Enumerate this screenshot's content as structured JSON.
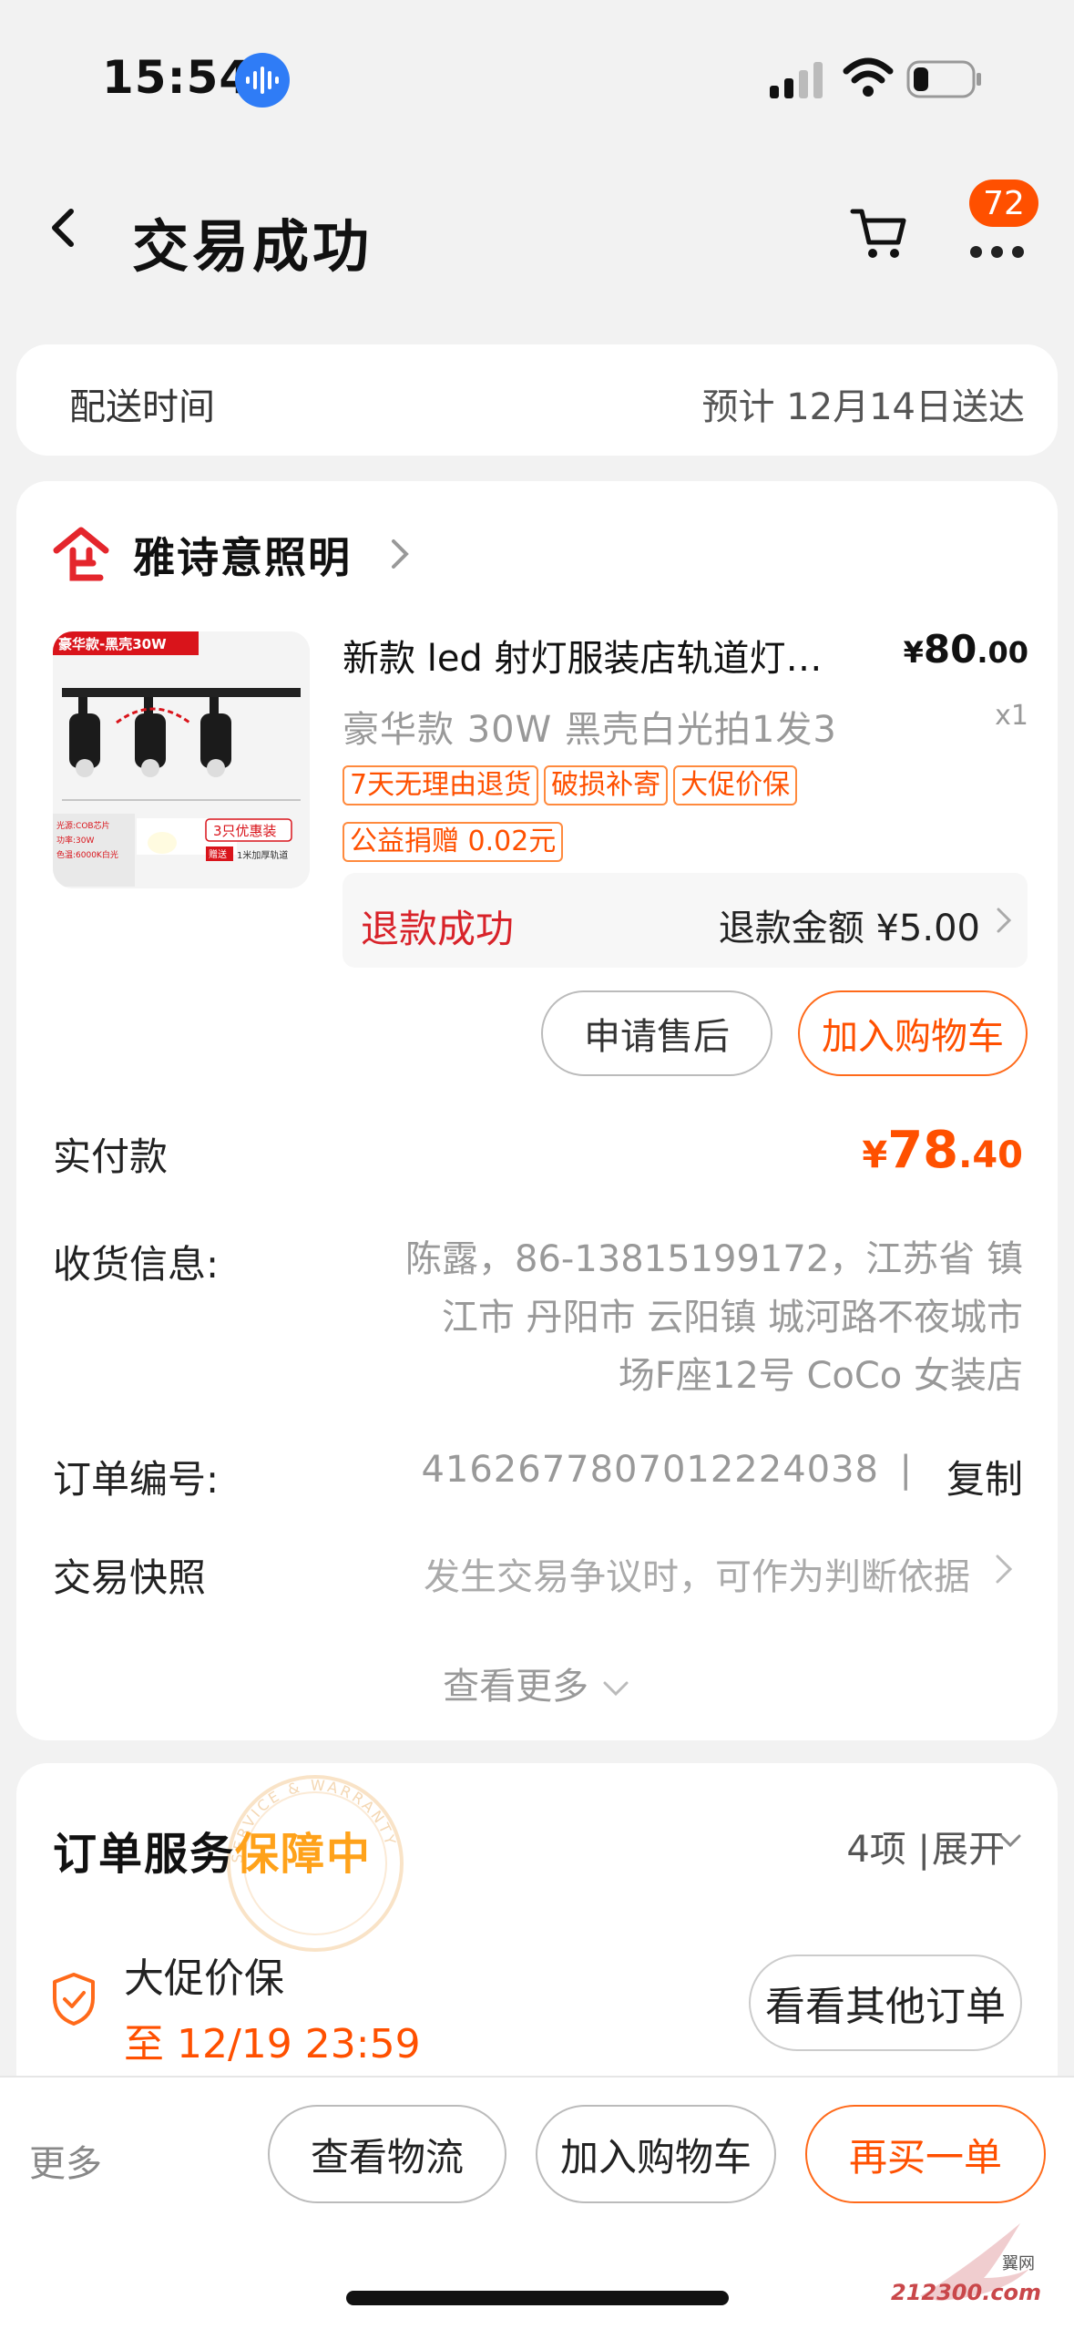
{
  "status_bar": {
    "time": "15:54"
  },
  "nav": {
    "title": "交易成功",
    "cart_badge": "72"
  },
  "delivery": {
    "label": "配送时间",
    "value": "预计 12月14日送达"
  },
  "shop": {
    "name": "雅诗意照明"
  },
  "product": {
    "title": "新款 led 射灯服装店轨道灯…",
    "price_symbol": "¥",
    "price_int": "80",
    "price_dec": ".00",
    "sku": "豪华款 30W 黑壳白光拍1发3",
    "qty": "x1",
    "tags": [
      "7天无理由退货",
      "破损补寄",
      "大促价保",
      "公益捐赠 0.02元"
    ],
    "image_text": {
      "banner": "豪华款-黑壳30W",
      "promo": "3只优惠装",
      "gift": "1米加厚轨道",
      "gift_label": "赠送",
      "spec": "光源:COB芯片",
      "spec2": "功率:30W",
      "spec3": "色温:6000K白光"
    }
  },
  "refund": {
    "status": "退款成功",
    "amount": "退款金额 ¥5.00"
  },
  "actions": {
    "after_sale": "申请售后",
    "add_cart": "加入购物车"
  },
  "payment": {
    "label": "实付款",
    "symbol": "¥",
    "int": "78",
    "dec": ".40"
  },
  "address": {
    "label": "收货信息:",
    "value_line1": "陈露，86-13815199172，江苏省 镇",
    "value_line2": "江市 丹阳市 云阳镇 城河路不夜城市",
    "value_line3": "场F座12号 CoCo 女装店"
  },
  "order_no": {
    "label": "订单编号:",
    "value": "4162677807012224038",
    "sep": "|",
    "copy": "复制"
  },
  "snapshot": {
    "label": "交易快照",
    "value": "发生交易争议时，可作为判断依据"
  },
  "see_more": "查看更多",
  "service": {
    "title_main": "订单服务",
    "title_highlight": "保障中",
    "count": "4项 |",
    "expand": "展开",
    "item": "大促价保",
    "deadline": "至 12/19 23:59",
    "other_orders": "看看其他订单",
    "seal_text": "SERVICE & WARRANTY"
  },
  "bottom_bar": {
    "more": "更多",
    "logistics": "查看物流",
    "add_cart": "加入购物车",
    "rebuy": "再买一单"
  },
  "watermark": {
    "brand": "212300.com",
    "top": "翼网"
  },
  "colors": {
    "accent": "#ff5000",
    "refund_red": "#d8232a",
    "highlight": "#ffa21a",
    "voice_blue": "#2f7cf6"
  }
}
